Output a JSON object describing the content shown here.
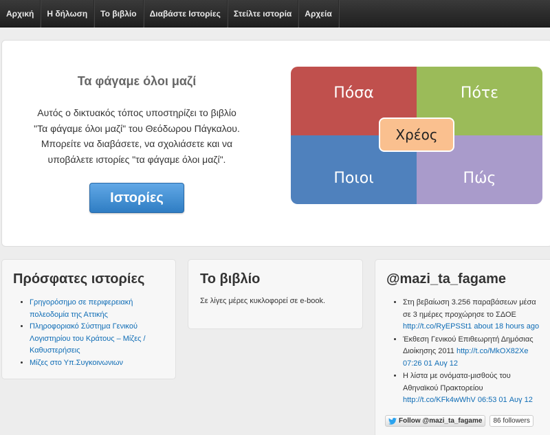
{
  "nav": {
    "items": [
      {
        "label": "Αρχική"
      },
      {
        "label": "Η δήλωση"
      },
      {
        "label": "Το βιβλίο"
      },
      {
        "label": "Διαβάστε Ιστορίες"
      },
      {
        "label": "Στείλτε ιστορία"
      },
      {
        "label": "Αρχεία"
      }
    ]
  },
  "hero": {
    "title": "Τα φάγαμε όλοι μαζί",
    "lines": [
      "Αυτός ο δικτυακός τόπος υποστηρίζει το βιβλίο",
      "\"Τα φάγαμε όλοι μαζί\" του Θεόδωρου Πάγκαλου.",
      "Μπορείτε να διαβάσετε, να σχολιάσετε και να",
      "υποβάλετε ιστορίες \"τα φάγαμε όλοι μαζί\"."
    ],
    "button_label": "Ιστορίες",
    "diagram": {
      "top_left": "Πόσα",
      "top_right": "Πότε",
      "bottom_left": "Ποιοι",
      "bottom_right": "Πώς",
      "center": "Χρέος",
      "colors": {
        "red": "#c0504d",
        "green": "#9bbb59",
        "blue": "#4f81bd",
        "purple": "#a99bcb",
        "center": "#fac08f"
      }
    }
  },
  "recent": {
    "title": "Πρόσφατες ιστορίες",
    "items": [
      "Γρηγορόσημο σε περιφερειακή πολεοδομία της Αττικής",
      "Πληροφοριακό Σύστημα Γενικού Λογιστηρίου του Κράτους – Μίζες / Καθυστερήσεις",
      "Μίζες στο Υπ.Συγκοινωνιων"
    ]
  },
  "book": {
    "title": "Το βιβλίο",
    "text": "Σε λίγες μέρες κυκλοφορεί σε e-book."
  },
  "twitter": {
    "title": "@mazi_ta_fagame",
    "tweets": [
      {
        "text": "Στη βεβαίωση 3.256 παραβάσεων μέσα σε 3 ημέρες προχώρησε το ΣΔΟΕ ",
        "link": "http://t.co/RyEPSSt1",
        "time": " about 18 hours ago"
      },
      {
        "text": "Έκθεση Γενικού Επιθεωρητή Δημόσιας Διοίκησης 2011 ",
        "link": "http://t.co/MkOX82Xe",
        "time": " 07:26 01 Αυγ 12"
      },
      {
        "text": "Η λίστα με ονόματα-μισθούς του Αθηναϊκού Πρακτορείου ",
        "link": "http://t.co/KFk4wWhV",
        "time": " 06:53 01 Αυγ 12"
      }
    ],
    "follow_label": "Follow @mazi_ta_fagame",
    "followers": "86 followers",
    "bird_icon": "twitter-bird-icon"
  }
}
